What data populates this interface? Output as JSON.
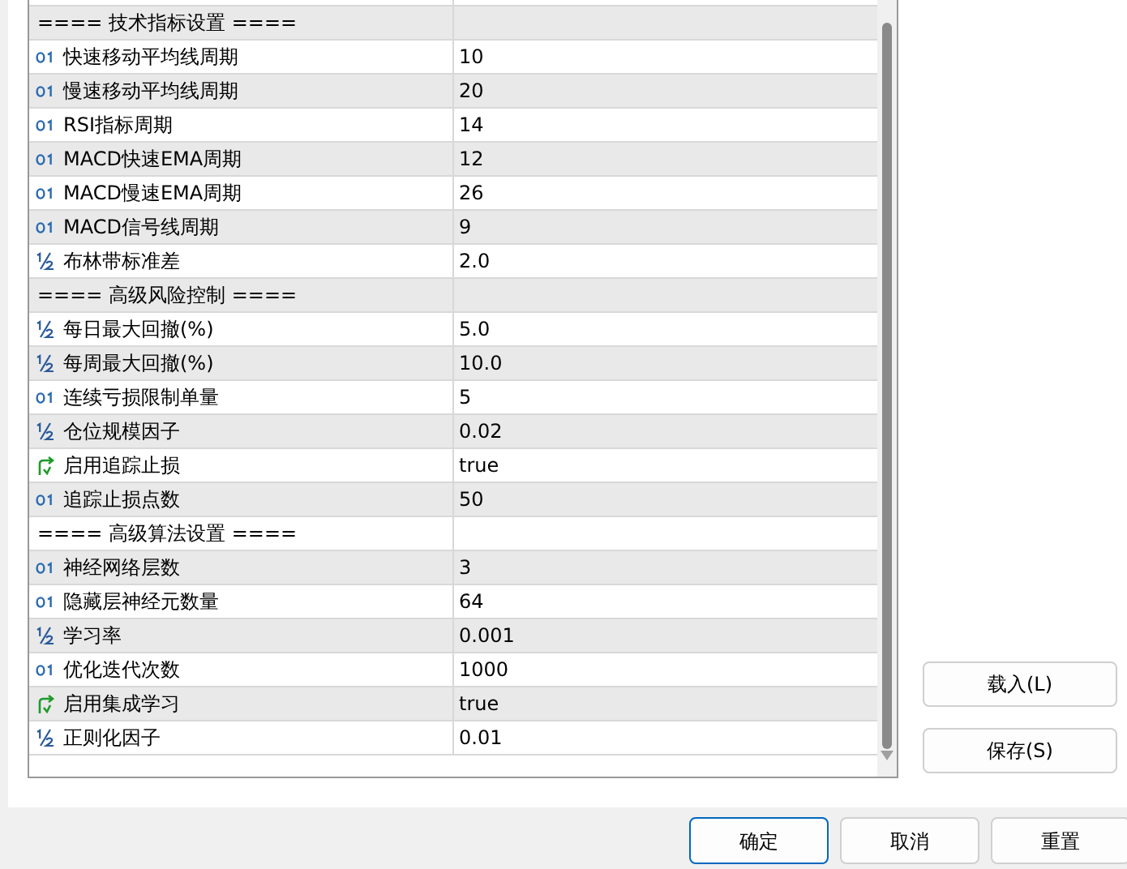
{
  "parameters": [
    {
      "kind": "header",
      "name": "==== 技术指标设置 ===="
    },
    {
      "kind": "int",
      "name": "快速移动平均线周期",
      "value": "10"
    },
    {
      "kind": "int",
      "name": "慢速移动平均线周期",
      "value": "20"
    },
    {
      "kind": "int",
      "name": "RSI指标周期",
      "value": "14"
    },
    {
      "kind": "int",
      "name": "MACD快速EMA周期",
      "value": "12"
    },
    {
      "kind": "int",
      "name": "MACD慢速EMA周期",
      "value": "26"
    },
    {
      "kind": "int",
      "name": "MACD信号线周期",
      "value": "9"
    },
    {
      "kind": "double",
      "name": "布林带标准差",
      "value": "2.0"
    },
    {
      "kind": "header",
      "name": "==== 高级风险控制 ===="
    },
    {
      "kind": "double",
      "name": "每日最大回撤(%)",
      "value": "5.0"
    },
    {
      "kind": "double",
      "name": "每周最大回撤(%)",
      "value": "10.0"
    },
    {
      "kind": "int",
      "name": "连续亏损限制单量",
      "value": "5"
    },
    {
      "kind": "double",
      "name": "仓位规模因子",
      "value": "0.02"
    },
    {
      "kind": "bool",
      "name": "启用追踪止损",
      "value": "true"
    },
    {
      "kind": "int",
      "name": "追踪止损点数",
      "value": "50"
    },
    {
      "kind": "header",
      "name": "==== 高级算法设置 ===="
    },
    {
      "kind": "int",
      "name": "神经网络层数",
      "value": "3"
    },
    {
      "kind": "int",
      "name": "隐藏层神经元数量",
      "value": "64"
    },
    {
      "kind": "double",
      "name": "学习率",
      "value": "0.001"
    },
    {
      "kind": "int",
      "name": "优化迭代次数",
      "value": "1000"
    },
    {
      "kind": "bool",
      "name": "启用集成学习",
      "value": "true"
    },
    {
      "kind": "double",
      "name": "正则化因子",
      "value": "0.01"
    }
  ],
  "side_buttons": [
    "载入(L)",
    "保存(S)"
  ],
  "dialog_buttons": [
    {
      "label": "确定",
      "default": true
    },
    {
      "label": "取消",
      "default": false
    },
    {
      "label": "重置",
      "default": false
    }
  ]
}
